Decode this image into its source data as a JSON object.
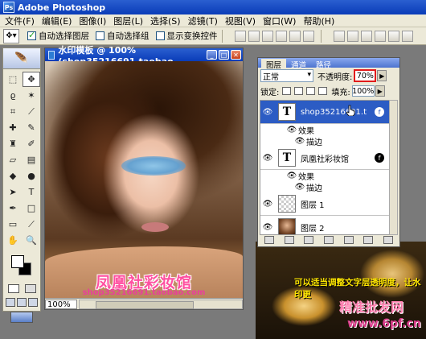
{
  "app": {
    "title": "Adobe Photoshop",
    "icon": "photoshop-icon"
  },
  "menu": [
    "文件(F)",
    "编辑(E)",
    "图像(I)",
    "图层(L)",
    "选择(S)",
    "滤镜(T)",
    "视图(V)",
    "窗口(W)",
    "帮助(H)"
  ],
  "options": {
    "auto_select_layer": "自动选择图层",
    "auto_select_group": "自动选择组",
    "show_transform_controls": "显示变换控件",
    "auto_select_layer_checked": true,
    "auto_select_group_checked": false,
    "show_transform_controls_checked": false
  },
  "document": {
    "title": "水印模板 @ 100% (shop35216691.taobao....",
    "zoom": "100%",
    "watermark_title": "凤凰社彩妆馆",
    "watermark_url": "shop35216691.taobao.com"
  },
  "layers_panel": {
    "tabs": [
      "图层",
      "通道",
      "路径"
    ],
    "blend_mode": "正常",
    "opacity_label": "不透明度:",
    "opacity_value": "70%",
    "lock_label": "锁定:",
    "fill_label": "填充:",
    "fill_value": "100%",
    "layers": [
      {
        "name": "shop35216691.tao...",
        "type": "text",
        "selected": true,
        "effects_label": "效果",
        "effect": "描边"
      },
      {
        "name": "凤凰社彩妆馆",
        "type": "text",
        "selected": false,
        "effects_label": "效果",
        "effect": "描边"
      },
      {
        "name": "图层 1",
        "type": "transparent",
        "selected": false
      },
      {
        "name": "图层 2",
        "type": "photo",
        "selected": false
      }
    ]
  },
  "overlay": {
    "tip": "可以适当调整文字层透明度，让水印更",
    "brand": "精准批发网",
    "brand_url": "www.6pf.cn"
  }
}
